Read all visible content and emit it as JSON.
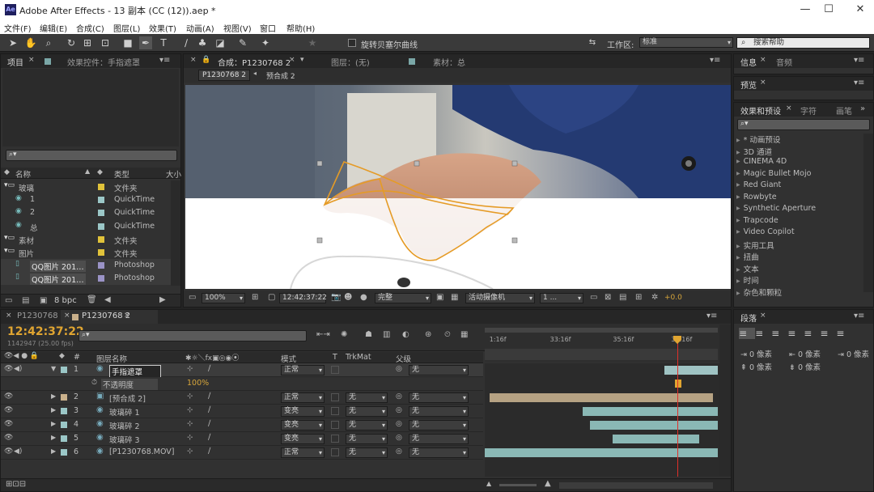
{
  "app": {
    "title": "Adobe After Effects - 13 副本 (CC (12)).aep *",
    "logo": "Ae"
  },
  "menu": [
    "文件(F)",
    "编辑(E)",
    "合成(C)",
    "图层(L)",
    "效果(T)",
    "动画(A)",
    "视图(V)",
    "窗口",
    "帮助(H)"
  ],
  "toolbar": {
    "bezier_label": "旋转贝塞尔曲线",
    "workspace_label": "工作区:",
    "workspace_value": "标准",
    "search_placeholder": "搜索帮助"
  },
  "project": {
    "tab": "项目",
    "effects_tab": "效果控件：手指遮罩",
    "col_name": "名称",
    "col_type": "类型",
    "col_size": "大小",
    "bpc": "8 bpc",
    "items": [
      {
        "name": "玻璃",
        "type": "文件夹",
        "indent": 0,
        "kind": "folder",
        "color": "#e0c23a"
      },
      {
        "name": "1",
        "type": "QuickTime",
        "indent": 1,
        "kind": "file",
        "color": "#9bc7c7"
      },
      {
        "name": "2",
        "type": "QuickTime",
        "indent": 1,
        "kind": "file",
        "color": "#9bc7c7"
      },
      {
        "name": "总",
        "type": "QuickTime",
        "indent": 1,
        "kind": "file",
        "color": "#9bc7c7"
      },
      {
        "name": "素材",
        "type": "文件夹",
        "indent": 0,
        "kind": "folder",
        "color": "#e0c23a"
      },
      {
        "name": "图片",
        "type": "文件夹",
        "indent": 0,
        "kind": "folder",
        "color": "#e0c23a"
      },
      {
        "name": "QQ图片 201…",
        "type": "Photoshop",
        "indent": 1,
        "kind": "image",
        "color": "#9a93c6"
      },
      {
        "name": "QQ图片 201…",
        "type": "Photoshop",
        "indent": 1,
        "kind": "image",
        "color": "#9a93c6"
      }
    ]
  },
  "composition": {
    "tab": "合成：P1230768 2",
    "layer_tab": "图层：(无)",
    "footage_tab": "素材：总",
    "crumbs": [
      "P1230768 2",
      "预合成 2"
    ],
    "zoom": "100%",
    "timecode": "12:42:37:22",
    "quality": "完整",
    "camera": "活动摄像机",
    "views": "1 ...",
    "exposure": "+0.0"
  },
  "right": {
    "info_tab": "信息",
    "audio_tab": "音频",
    "preview_tab": "预览",
    "effects_tab": "效果和预设",
    "char_tab": "字符",
    "paint_tab": "画笔",
    "effects": [
      "* 动画预设",
      "3D 通道",
      "CINEMA 4D",
      "Magic Bullet Mojo",
      "Red Giant",
      "Rowbyte",
      "Synthetic Aperture",
      "Trapcode",
      "Video Copilot",
      "实用工具",
      "扭曲",
      "文本",
      "时间",
      "杂色和颗粒"
    ],
    "para_tab": "段落",
    "para_values": [
      "0 像素",
      "0 像素",
      "0 像素",
      "0 像素",
      "0 像素"
    ]
  },
  "timeline": {
    "tab1": "P1230768",
    "tab2": "P1230768 2",
    "timecode": "12:42:37:22",
    "frames": "1142947 (25.00 fps)",
    "col_layer": "图层名称",
    "col_mode": "模式",
    "col_t": "T",
    "col_trkmat": "TrkMat",
    "col_parent": "父级",
    "ruler": [
      "1:16f",
      "33:16f",
      "35:16f",
      "37:16f"
    ],
    "opacity_label": "不透明度",
    "opacity_value": "100%",
    "layers": [
      {
        "num": "1",
        "name": "手指遮罩",
        "mode": "正常",
        "trkmat": "",
        "parent": "无",
        "color": "#9bc7c7",
        "bar_color": "#9fc3c3",
        "start": 0.77,
        "end": 1.0
      },
      {
        "num": "2",
        "name": "[预合成 2]",
        "mode": "正常",
        "trkmat": "无",
        "parent": "无",
        "color": "#c9b08b",
        "bar_color": "#b6a283",
        "start": 0.02,
        "end": 0.98
      },
      {
        "num": "3",
        "name": "玻璃碎 1",
        "mode": "变亮",
        "trkmat": "无",
        "parent": "无",
        "color": "#9bc7c7",
        "bar_color": "#8ab8b5",
        "start": 0.42,
        "end": 1.0
      },
      {
        "num": "4",
        "name": "玻璃碎 2",
        "mode": "变亮",
        "trkmat": "无",
        "parent": "无",
        "color": "#9bc7c7",
        "bar_color": "#8ab8b5",
        "start": 0.45,
        "end": 1.0
      },
      {
        "num": "5",
        "name": "玻璃碎 3",
        "mode": "变亮",
        "trkmat": "无",
        "parent": "无",
        "color": "#9bc7c7",
        "bar_color": "#8ab8b5",
        "start": 0.55,
        "end": 0.92
      },
      {
        "num": "6",
        "name": "[P1230768.MOV]",
        "mode": "正常",
        "trkmat": "无",
        "parent": "无",
        "color": "#9bc7c7",
        "bar_color": "#8ab8b5",
        "start": 0.0,
        "end": 1.0
      }
    ]
  }
}
